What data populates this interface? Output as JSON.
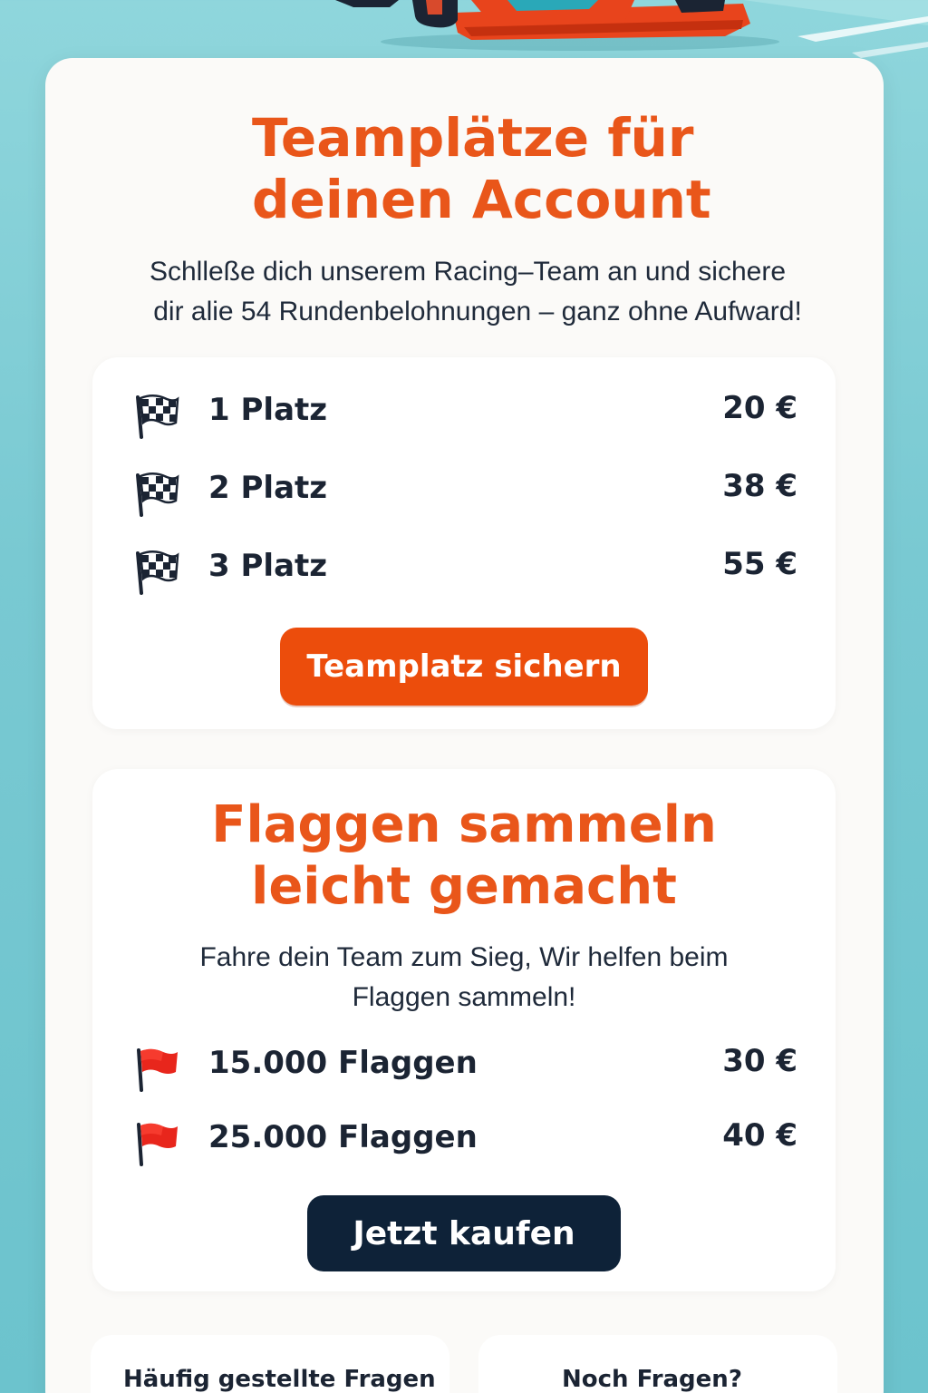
{
  "hero": {
    "image": "race-car-illustration"
  },
  "team_section": {
    "title_line1": "Teamplätze für",
    "title_line2": "deinen Account",
    "intro_line1": "Schlleße dich unserem Racing–Team an und sichere",
    "intro_line2": "dir alie 54 Rundenbelohnungen – ganz ohne Aufward!",
    "items": [
      {
        "icon": "checkered-flag-icon",
        "label": "1 Platz",
        "price": "20 €"
      },
      {
        "icon": "checkered-flag-icon",
        "label": "2 Platz",
        "price": "38 €"
      },
      {
        "icon": "checkered-flag-icon",
        "label": "3 Platz",
        "price": "55 €"
      }
    ],
    "button_label": "Teamplatz sichern"
  },
  "flags_section": {
    "title_line1": "Flaggen sammeln",
    "title_line2": "leicht gemacht",
    "intro_line1": "Fahre dein Team zum Sieg, Wir helfen beim",
    "intro_line2": "Flaggen sammeln!",
    "items": [
      {
        "icon": "red-flag-icon",
        "label": "15.000 Flaggen",
        "price": "30 €"
      },
      {
        "icon": "red-flag-icon",
        "label": "25.000 Flaggen",
        "price": "40 €"
      }
    ],
    "button_label": "Jetzt kaufen"
  },
  "footer": {
    "faq_label": "Häufig gestellte Fragen",
    "contact_label": "Noch Fragen?"
  },
  "colors": {
    "accent": "#e9561a",
    "button_orange": "#ec4d0c",
    "button_navy": "#0e2238",
    "background": "#7fcdd5"
  }
}
